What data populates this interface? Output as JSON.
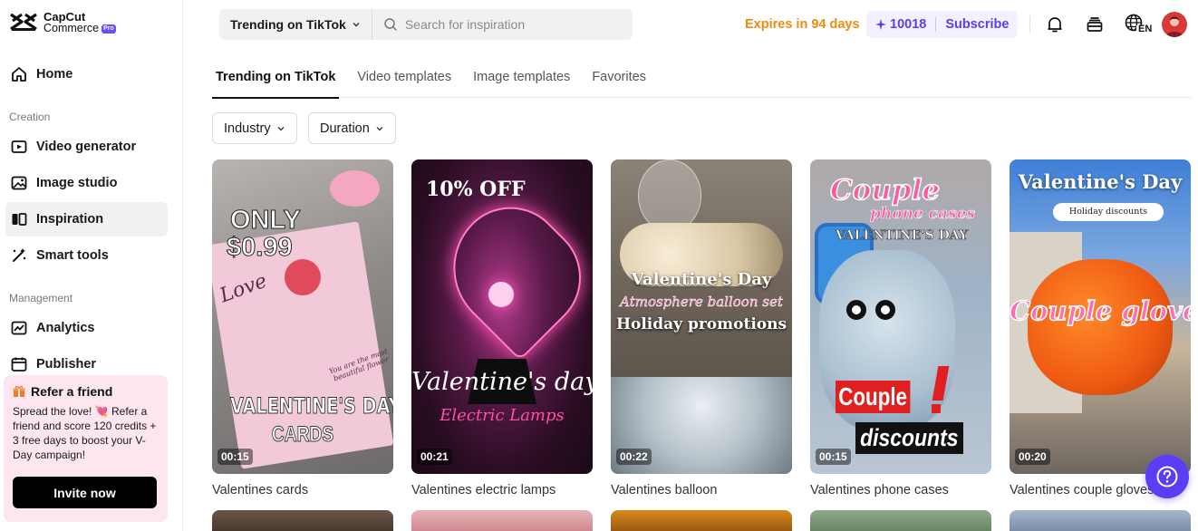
{
  "brand": {
    "name": "CapCut",
    "sub": "Commerce",
    "badge": "Pro"
  },
  "nav": {
    "home": "Home",
    "creation_label": "Creation",
    "video_generator": "Video generator",
    "image_studio": "Image studio",
    "inspiration": "Inspiration",
    "smart_tools": "Smart tools",
    "management_label": "Management",
    "analytics": "Analytics",
    "publisher": "Publisher"
  },
  "refer": {
    "title": "Refer a friend",
    "body": "Spread the love! 💘 Refer a friend and score 120 credits + 3 free days to boost your V-Day campaign!",
    "button": "Invite now"
  },
  "header": {
    "search_category": "Trending on TikTok",
    "search_placeholder": "Search for inspiration",
    "expires": "Expires in 94 days",
    "credits": "10018",
    "subscribe": "Subscribe",
    "language": "EN"
  },
  "tabs": [
    "Trending on TikTok",
    "Video templates",
    "Image templates",
    "Favorites"
  ],
  "filters": {
    "industry": "Industry",
    "duration": "Duration"
  },
  "cards": [
    {
      "title": "Valentines cards",
      "duration": "00:15",
      "overlay": [
        "ONLY",
        "$0.99",
        "Love",
        "VALENTINE'S DAY",
        "CARDS",
        "You are the most beautiful flower"
      ]
    },
    {
      "title": "Valentines electric lamps",
      "duration": "00:21",
      "overlay": [
        "10% OFF",
        "Valentine's day",
        "Electric Lamps"
      ]
    },
    {
      "title": "Valentines balloon",
      "duration": "00:22",
      "overlay": [
        "Valentine's Day",
        "Atmosphere balloon set",
        "Holiday promotions"
      ]
    },
    {
      "title": "Valentines phone cases",
      "duration": "00:15",
      "overlay": [
        "Couple",
        "phone cases",
        "VALENTINE'S DAY",
        "Couple",
        "discounts"
      ]
    },
    {
      "title": "Valentines couple gloves",
      "duration": "00:20",
      "overlay": [
        "Valentine's Day",
        "Holiday discounts",
        "Couple gloves"
      ]
    }
  ],
  "colors": {
    "accent": "#5b3df5",
    "expires": "#f08a12",
    "refer_bg": "#fde6ef",
    "active_nav": "#f1f1f3"
  }
}
